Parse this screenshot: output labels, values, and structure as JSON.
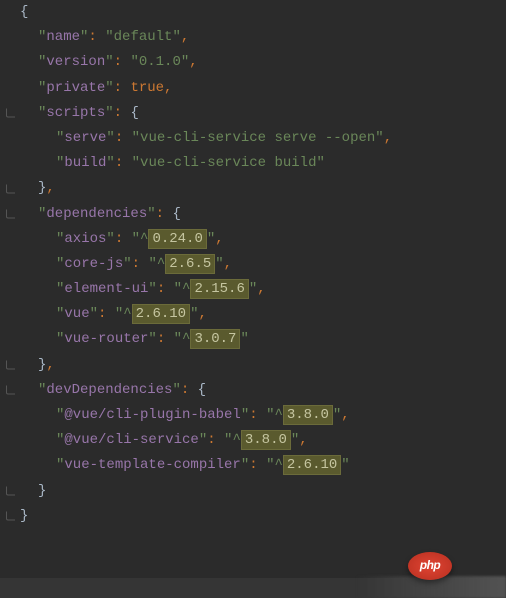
{
  "json": {
    "name_key": "name",
    "name_val": "default",
    "version_key": "version",
    "version_val": "0.1.0",
    "private_key": "private",
    "private_val": "true",
    "scripts_key": "scripts",
    "scripts": {
      "serve_key": "serve",
      "serve_val": "vue-cli-service serve --open",
      "build_key": "build",
      "build_val": "vue-cli-service build"
    },
    "dependencies_key": "dependencies",
    "dependencies": {
      "axios_key": "axios",
      "axios_pre": "^",
      "axios_ver": "0.24.0",
      "corejs_key": "core-js",
      "corejs_pre": "^",
      "corejs_ver": "2.6.5",
      "elementui_key": "element-ui",
      "elementui_pre": "^",
      "elementui_ver": "2.15.6",
      "vue_key": "vue",
      "vue_pre": "^",
      "vue_ver": "2.6.10",
      "vuerouter_key": "vue-router",
      "vuerouter_pre": "^",
      "vuerouter_ver": "3.0.7"
    },
    "devDependencies_key": "devDependencies",
    "devDependencies": {
      "babel_key": "@vue/cli-plugin-babel",
      "babel_pre": "^",
      "babel_ver": "3.8.0",
      "cliservice_key": "@vue/cli-service",
      "cliservice_pre": "^",
      "cliservice_ver": "3.8.0",
      "compiler_key": "vue-template-compiler",
      "compiler_pre": "^",
      "compiler_ver": "2.6.10"
    }
  },
  "badge": "php"
}
